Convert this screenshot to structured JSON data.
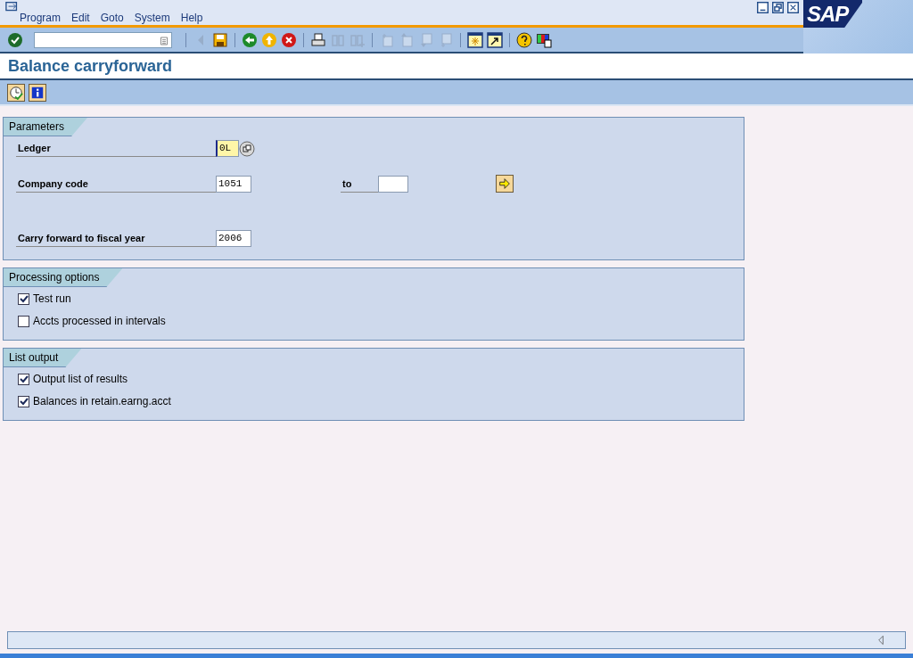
{
  "menu": [
    {
      "label": "Program"
    },
    {
      "label": "Edit"
    },
    {
      "label": "Goto"
    },
    {
      "label": "System"
    },
    {
      "label": "Help"
    }
  ],
  "logo": "SAP",
  "toolbar": [
    {
      "kind": "enter",
      "disabled": false
    },
    {
      "kind": "sep"
    },
    {
      "kind": "prev",
      "disabled": true
    },
    {
      "kind": "save",
      "disabled": false
    },
    {
      "kind": "sep"
    },
    {
      "kind": "back",
      "disabled": false
    },
    {
      "kind": "exit",
      "disabled": false
    },
    {
      "kind": "cancel",
      "disabled": false
    },
    {
      "kind": "sep"
    },
    {
      "kind": "print",
      "disabled": false
    },
    {
      "kind": "find",
      "disabled": true
    },
    {
      "kind": "findnext",
      "disabled": true
    },
    {
      "kind": "sep"
    },
    {
      "kind": "first",
      "disabled": true
    },
    {
      "kind": "pageup",
      "disabled": true
    },
    {
      "kind": "pagedown",
      "disabled": true
    },
    {
      "kind": "last",
      "disabled": true
    },
    {
      "kind": "sep"
    },
    {
      "kind": "newsession",
      "disabled": false
    },
    {
      "kind": "shortcut",
      "disabled": false
    },
    {
      "kind": "sep"
    },
    {
      "kind": "help",
      "disabled": false
    },
    {
      "kind": "layout",
      "disabled": false
    }
  ],
  "title": "Balance carryforward",
  "app_toolbar": [
    {
      "kind": "execute"
    },
    {
      "kind": "info"
    }
  ],
  "groups": [
    {
      "title": "Parameters",
      "kind": "fields",
      "rows": [
        {
          "label": "Ledger",
          "value": "0L",
          "focused": true,
          "f4": true
        },
        {
          "label": "Company code",
          "value": "1051",
          "focused": false,
          "to_label": "to",
          "to_value": "",
          "multiple": true
        },
        {
          "label": "Carry forward to fiscal year",
          "value": "2006",
          "focused": false,
          "gap": true
        }
      ]
    },
    {
      "title": "Processing options",
      "kind": "checks",
      "rows": [
        {
          "label": "Test run",
          "checked": true
        },
        {
          "label": "Accts processed in intervals",
          "checked": false
        }
      ]
    },
    {
      "title": "List output",
      "kind": "checks",
      "rows": [
        {
          "label": "Output list of results",
          "checked": true
        },
        {
          "label": "Balances in retain.earng.acct",
          "checked": true
        }
      ]
    }
  ]
}
